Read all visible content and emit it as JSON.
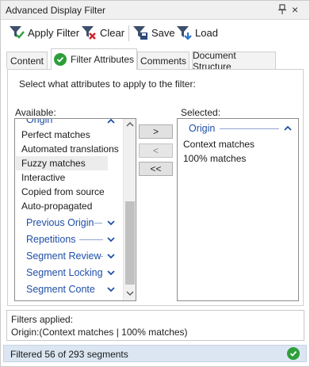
{
  "window": {
    "title": "Advanced Display Filter",
    "pin_icon": "pin-icon",
    "close_glyph": "×"
  },
  "toolbar": {
    "apply_label": "Apply Filter",
    "clear_label": "Clear",
    "save_label": "Save",
    "load_label": "Load"
  },
  "tabs": [
    {
      "label": "Content"
    },
    {
      "label": "Filter Attributes",
      "active": true
    },
    {
      "label": "Comments"
    },
    {
      "label": "Document Structure"
    }
  ],
  "filter_attributes": {
    "instruction": "Select what attributes to apply to the filter:",
    "available_label": "Available:",
    "selected_label": "Selected:",
    "available": {
      "partial_group": "Origin",
      "items": [
        "Perfect matches",
        "Automated translations",
        "Fuzzy matches",
        "Interactive",
        "Copied from source",
        "Auto-propagated"
      ],
      "highlighted_item": "Fuzzy matches",
      "groups": [
        "Previous Origin",
        "Repetitions",
        "Segment Review",
        "Segment Locking",
        "Segment Conte"
      ]
    },
    "buttons": {
      "add": ">",
      "remove": "<",
      "remove_all": "<<"
    },
    "selected": {
      "group": "Origin",
      "items": [
        "Context matches",
        "100% matches"
      ]
    }
  },
  "footer": {
    "applied_title": "Filters applied:",
    "applied_value": "Origin:(Context matches | 100% matches)",
    "status_text": "Filtered 56 of 293 segments"
  },
  "colors": {
    "group_blue": "#1f4fa8",
    "check_green": "#2e9e3b",
    "status_bg": "#dbe6f2"
  }
}
